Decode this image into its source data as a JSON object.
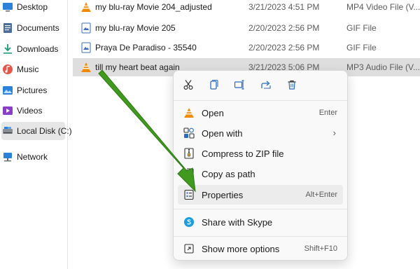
{
  "sidebar": {
    "items": [
      {
        "label": "Desktop",
        "icon": "desktop-icon"
      },
      {
        "label": "Documents",
        "icon": "documents-icon"
      },
      {
        "label": "Downloads",
        "icon": "downloads-icon"
      },
      {
        "label": "Music",
        "icon": "music-icon"
      },
      {
        "label": "Pictures",
        "icon": "pictures-icon"
      },
      {
        "label": "Videos",
        "icon": "videos-icon"
      },
      {
        "label": "Local Disk (C:)",
        "icon": "drive-icon",
        "selected": true
      },
      {
        "label": "Network",
        "icon": "network-icon"
      }
    ]
  },
  "files": [
    {
      "name": "my blu-ray Movie 204_adjusted",
      "date": "3/21/2023 4:51 PM",
      "type": "MP4 Video File (V...",
      "icon": "vlc-icon"
    },
    {
      "name": "my blu-ray Movie 205",
      "date": "2/20/2023 2:56 PM",
      "type": "GIF File",
      "icon": "gif-file-icon"
    },
    {
      "name": "Praya De Paradiso - 35540",
      "date": "2/20/2023 2:56 PM",
      "type": "GIF File",
      "icon": "gif-file-icon"
    },
    {
      "name": "till my heart beat again",
      "date": "3/21/2023 5:06 PM",
      "type": "MP3 Audio File (V...",
      "icon": "vlc-icon",
      "selected": true
    }
  ],
  "context_menu": {
    "quick_actions": [
      "cut-icon",
      "copy-icon",
      "rename-icon",
      "share-icon",
      "delete-icon"
    ],
    "items": [
      {
        "label": "Open",
        "shortcut": "Enter",
        "icon": "vlc-icon"
      },
      {
        "label": "Open with",
        "shortcut": "",
        "icon": "open-with-icon",
        "submenu": true
      },
      {
        "label": "Compress to ZIP file",
        "shortcut": "",
        "icon": "zip-icon"
      },
      {
        "label": "Copy as path",
        "shortcut": "",
        "icon": "copy-path-icon"
      },
      {
        "label": "Properties",
        "shortcut": "Alt+Enter",
        "icon": "properties-icon",
        "highlighted": true
      },
      {
        "label": "Share with Skype",
        "shortcut": "",
        "icon": "skype-icon"
      },
      {
        "label": "Show more options",
        "shortcut": "Shift+F10",
        "icon": "more-options-icon"
      }
    ],
    "submenu_glyph": "›"
  },
  "colors": {
    "annotation_arrow": "#3f9a1e",
    "accent": "#2b6cc4",
    "vlc_orange": "#f08a00"
  }
}
